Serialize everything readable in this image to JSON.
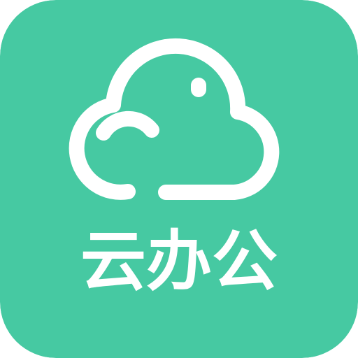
{
  "app_icon": {
    "name": "云办公",
    "background_color": "#46C9A2",
    "foreground_color": "#FFFFFF",
    "icon": "cloud-icon"
  }
}
